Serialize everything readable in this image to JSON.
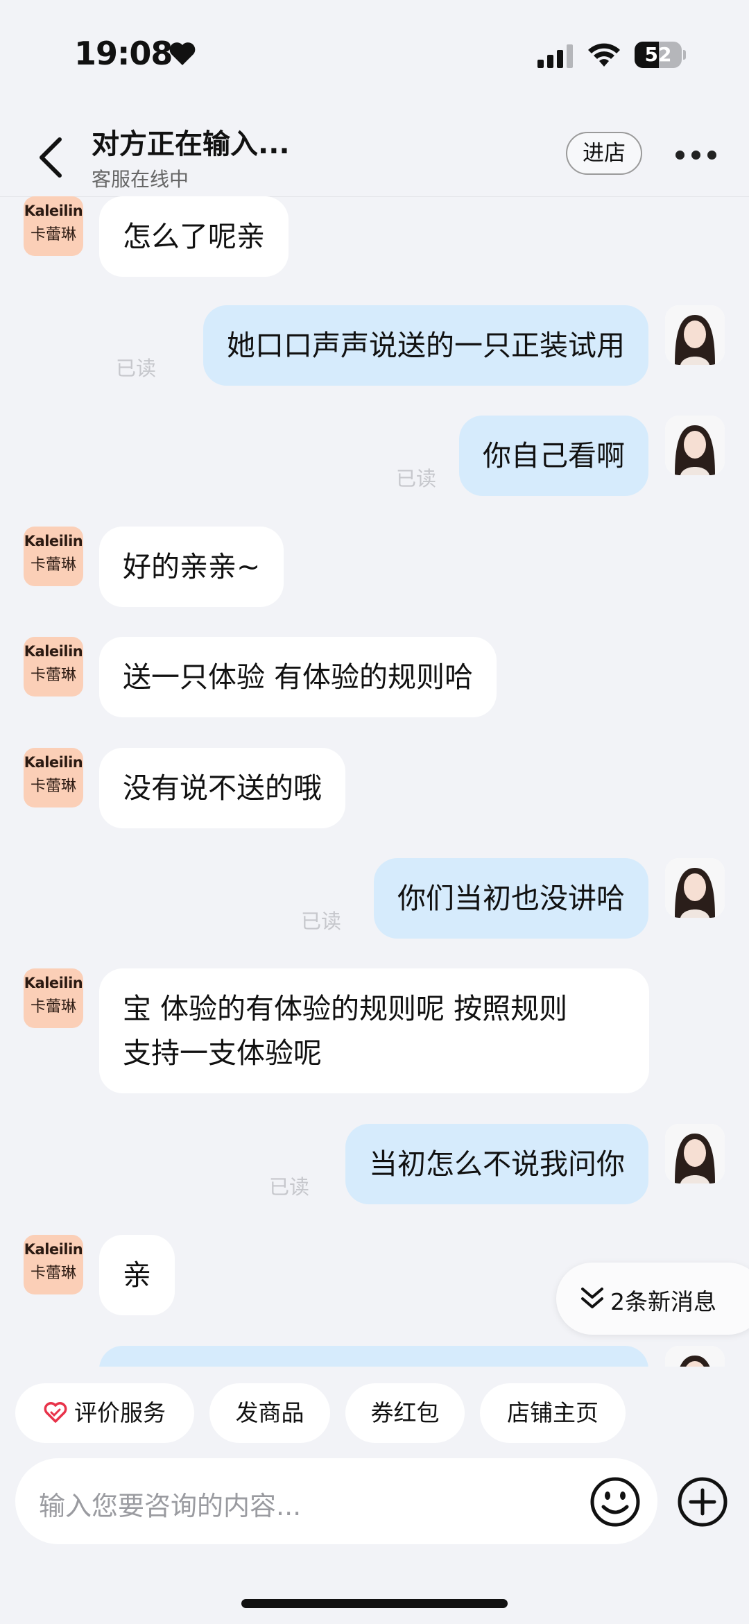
{
  "status_bar": {
    "time": "19:08",
    "battery": "52",
    "battery_level": 0.52
  },
  "header": {
    "title": "对方正在输入...",
    "subtitle": "客服在线中",
    "enter_store": "进店"
  },
  "shop": {
    "logo_line1": "Kaleilin",
    "logo_line2": "卡蕾琳"
  },
  "messages": [
    {
      "side": "left",
      "text": "怎么了呢亲"
    },
    {
      "side": "right",
      "text": "她口口声声说送的一只正装试用",
      "status": "已读"
    },
    {
      "side": "right",
      "text": "你自己看啊",
      "status": "已读"
    },
    {
      "side": "left",
      "text": "好的亲亲~"
    },
    {
      "side": "left",
      "text": "送一只体验 有体验的规则哈"
    },
    {
      "side": "left",
      "text": "没有说不送的哦"
    },
    {
      "side": "right",
      "text": "你们当初也没讲哈",
      "status": "已读"
    },
    {
      "side": "left",
      "text": "宝 体验的有体验的规则呢 按照规则\n支持一支体验呢"
    },
    {
      "side": "right",
      "text": "当初怎么不说我问你",
      "status": "已读"
    },
    {
      "side": "left",
      "text": "亲"
    }
  ],
  "new_messages": "2条新消息",
  "quick_actions": [
    "评价服务",
    "发商品",
    "券红包",
    "店铺主页"
  ],
  "input": {
    "placeholder": "输入您要咨询的内容..."
  },
  "colors": {
    "user_bubble": "#d6ebfc",
    "shop_bubble": "#ffffff",
    "background": "#f2f3f7",
    "logo_bg": "#fbcfb7"
  }
}
